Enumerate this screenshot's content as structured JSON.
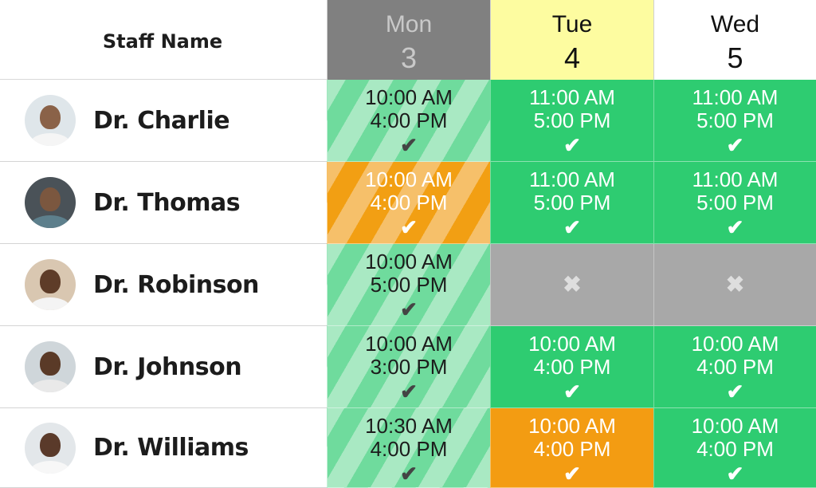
{
  "header": {
    "staff_label": "Staff Name",
    "days": [
      {
        "name": "Mon",
        "num": "3",
        "state": "past"
      },
      {
        "name": "Tue",
        "num": "4",
        "state": "today"
      },
      {
        "name": "Wed",
        "num": "5",
        "state": "future"
      }
    ]
  },
  "colors": {
    "available": "#2ecc71",
    "partial": "#f39c12",
    "unavailable": "#a8a8a8",
    "today": "#fdfca0",
    "past_header": "#808080"
  },
  "staff": [
    {
      "name": "Dr. Charlie",
      "shifts": [
        {
          "start": "10:00 AM",
          "end": "4:00 PM",
          "status": "check",
          "color": "green-striped"
        },
        {
          "start": "11:00 AM",
          "end": "5:00 PM",
          "status": "check",
          "color": "green"
        },
        {
          "start": "11:00 AM",
          "end": "5:00 PM",
          "status": "check",
          "color": "green"
        }
      ]
    },
    {
      "name": "Dr. Thomas",
      "shifts": [
        {
          "start": "10:00 AM",
          "end": "4:00 PM",
          "status": "check",
          "color": "orange-striped"
        },
        {
          "start": "11:00 AM",
          "end": "5:00 PM",
          "status": "check",
          "color": "green"
        },
        {
          "start": "11:00 AM",
          "end": "5:00 PM",
          "status": "check",
          "color": "green"
        }
      ]
    },
    {
      "name": "Dr. Robinson",
      "shifts": [
        {
          "start": "10:00 AM",
          "end": "5:00 PM",
          "status": "check",
          "color": "green-striped"
        },
        {
          "start": "",
          "end": "",
          "status": "cross",
          "color": "grey"
        },
        {
          "start": "",
          "end": "",
          "status": "cross",
          "color": "grey"
        }
      ]
    },
    {
      "name": "Dr. Johnson",
      "shifts": [
        {
          "start": "10:00 AM",
          "end": "3:00 PM",
          "status": "check",
          "color": "green-striped"
        },
        {
          "start": "10:00 AM",
          "end": "4:00 PM",
          "status": "check",
          "color": "green"
        },
        {
          "start": "10:00 AM",
          "end": "4:00 PM",
          "status": "check",
          "color": "green"
        }
      ]
    },
    {
      "name": "Dr. Williams",
      "shifts": [
        {
          "start": "10:30 AM",
          "end": "4:00 PM",
          "status": "check",
          "color": "green-striped"
        },
        {
          "start": "10:00 AM",
          "end": "4:00 PM",
          "status": "check",
          "color": "orange"
        },
        {
          "start": "10:00 AM",
          "end": "4:00 PM",
          "status": "check",
          "color": "green"
        }
      ]
    }
  ]
}
